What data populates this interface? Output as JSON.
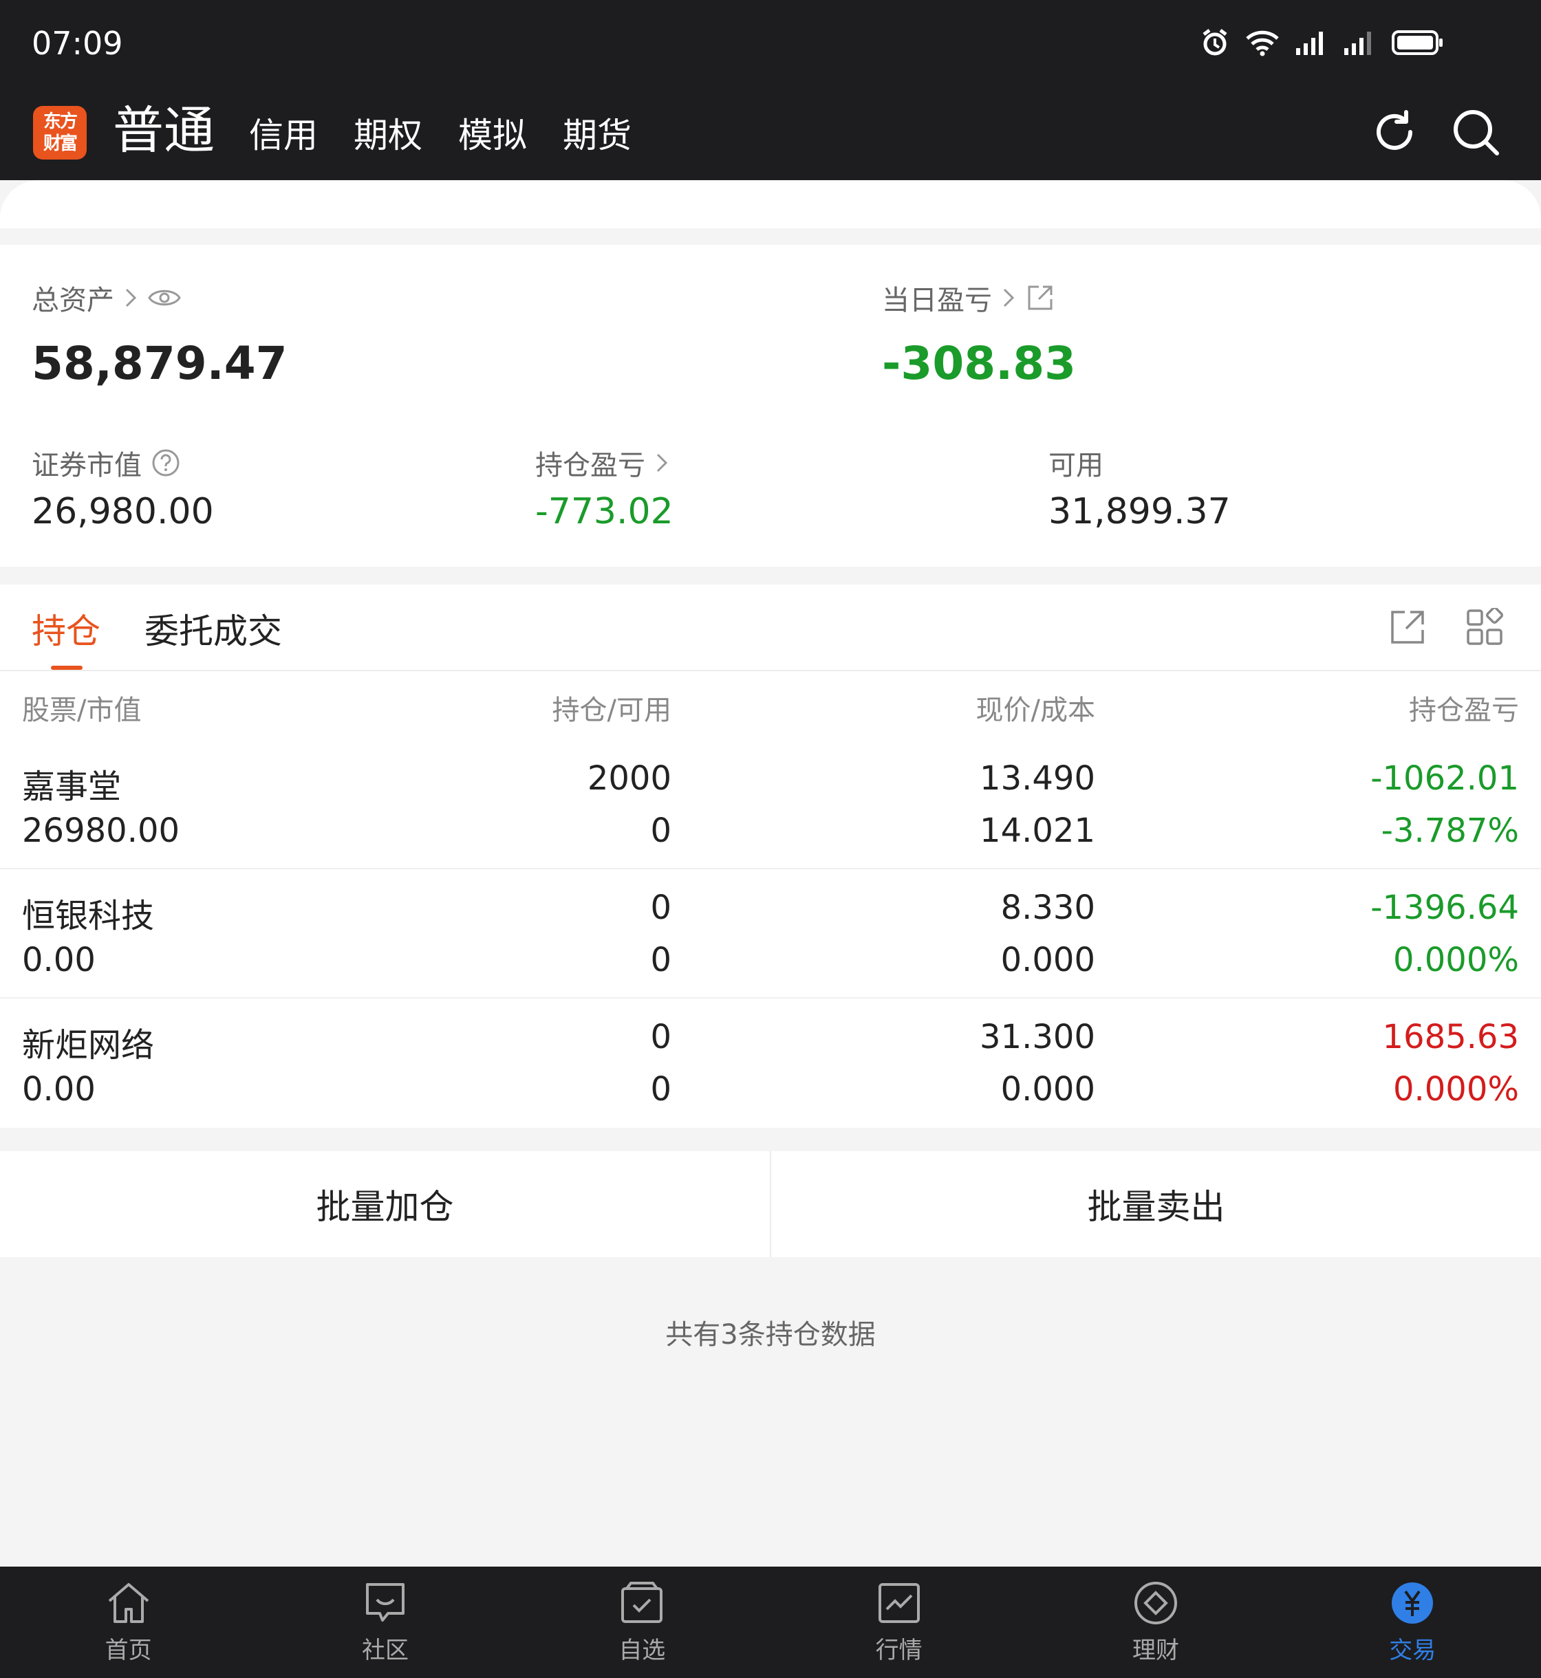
{
  "status_bar": {
    "time": "07:09"
  },
  "header": {
    "logo_line1": "东方",
    "logo_line2": "财富",
    "tabs": [
      {
        "label": "普通"
      },
      {
        "label": "信用"
      },
      {
        "label": "期权"
      },
      {
        "label": "模拟"
      },
      {
        "label": "期货"
      }
    ]
  },
  "summary": {
    "total_assets_label": "总资产",
    "total_assets_value": "58,879.47",
    "daily_pnl_label": "当日盈亏",
    "daily_pnl_value": "-308.83",
    "market_value_label": "证券市值",
    "market_value": "26,980.00",
    "position_pnl_label": "持仓盈亏",
    "position_pnl": "-773.02",
    "available_label": "可用",
    "available": "31,899.37"
  },
  "positions": {
    "tab_holdings": "持仓",
    "tab_orders": "委托成交",
    "columns": [
      "股票/市值",
      "持仓/可用",
      "现价/成本",
      "持仓盈亏"
    ],
    "rows": [
      {
        "name": "嘉事堂",
        "market_value": "26980.00",
        "qty": "2000",
        "avail": "0",
        "price": "13.490",
        "cost": "14.021",
        "pnl": "-1062.01",
        "pnl_pct": "-3.787%",
        "color": "#1a9b2a"
      },
      {
        "name": "恒银科技",
        "market_value": "0.00",
        "qty": "0",
        "avail": "0",
        "price": "8.330",
        "cost": "0.000",
        "pnl": "-1396.64",
        "pnl_pct": "0.000%",
        "color": "#1a9b2a"
      },
      {
        "name": "新炬网络",
        "market_value": "0.00",
        "qty": "0",
        "avail": "0",
        "price": "31.300",
        "cost": "0.000",
        "pnl": "1685.63",
        "pnl_pct": "0.000%",
        "color": "#d41c1c"
      }
    ]
  },
  "actions": {
    "batch_add": "批量加仓",
    "batch_sell": "批量卖出"
  },
  "footer_note": "共有3条持仓数据",
  "bottom_nav": [
    {
      "label": "首页",
      "icon": "home-icon"
    },
    {
      "label": "社区",
      "icon": "chat-icon"
    },
    {
      "label": "自选",
      "icon": "watchlist-icon"
    },
    {
      "label": "行情",
      "icon": "chart-icon"
    },
    {
      "label": "理财",
      "icon": "diamond-icon"
    },
    {
      "label": "交易",
      "icon": "yuan-icon"
    }
  ],
  "colors": {
    "accent": "#e8531e",
    "down": "#1a9b2a",
    "up": "#d41c1c",
    "nav_active": "#2f7fe6"
  }
}
